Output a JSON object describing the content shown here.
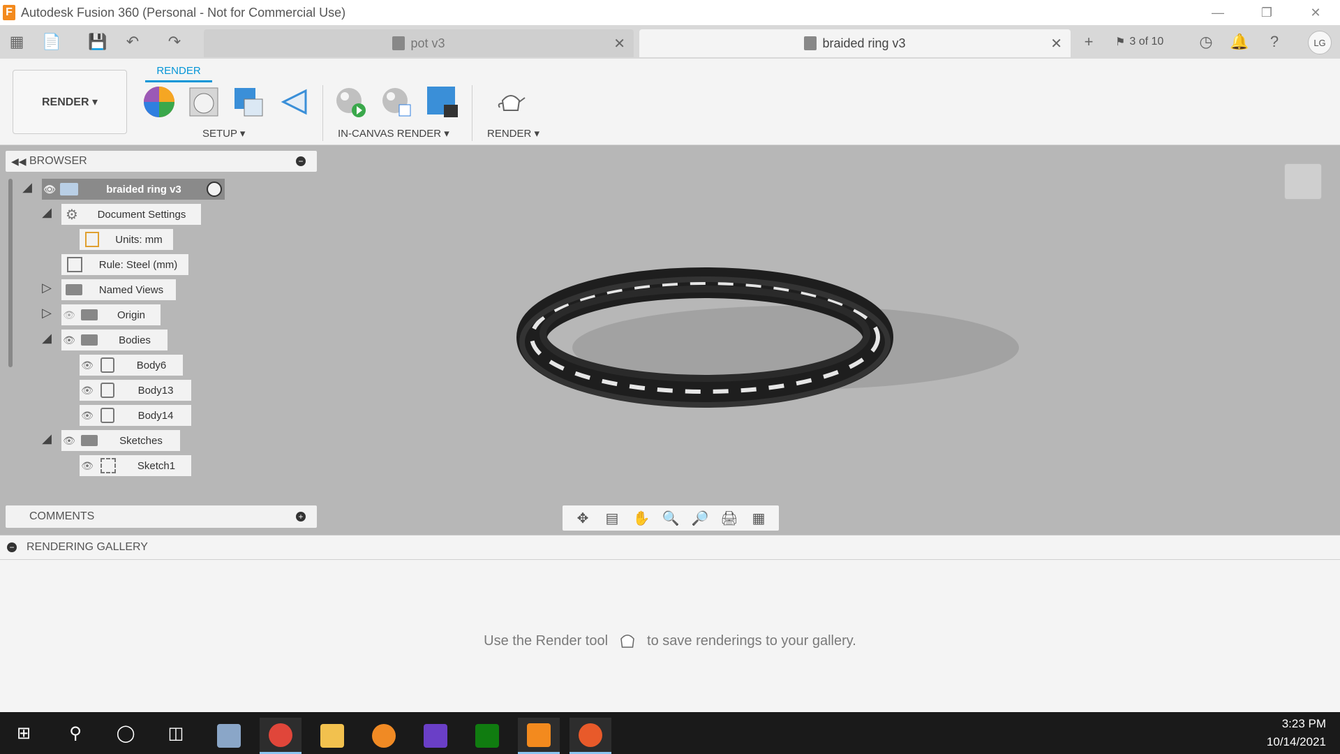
{
  "window": {
    "title": "Autodesk Fusion 360 (Personal - Not for Commercial Use)",
    "app_logo_letter": "F"
  },
  "tabs": [
    {
      "label": "pot v3",
      "active": false
    },
    {
      "label": "braided ring v3",
      "active": true
    }
  ],
  "quick_bar": {
    "version_counter": "3 of 10",
    "user_initials": "LG"
  },
  "ribbon": {
    "workspace": "RENDER ▾",
    "active_tab": "RENDER",
    "groups": [
      {
        "label": "SETUP ▾"
      },
      {
        "label": "IN-CANVAS RENDER ▾"
      },
      {
        "label": "RENDER ▾"
      }
    ]
  },
  "browser": {
    "title": "BROWSER",
    "root": "braided ring v3",
    "items": [
      {
        "label": "Document Settings"
      },
      {
        "label": "Units: mm"
      },
      {
        "label": "Rule: Steel (mm)"
      },
      {
        "label": "Named Views"
      },
      {
        "label": "Origin"
      },
      {
        "label": "Bodies"
      },
      {
        "label": "Body6"
      },
      {
        "label": "Body13"
      },
      {
        "label": "Body14"
      },
      {
        "label": "Sketches"
      },
      {
        "label": "Sketch1"
      }
    ]
  },
  "comments": {
    "title": "COMMENTS"
  },
  "gallery": {
    "title": "RENDERING GALLERY",
    "message_before": "Use the Render tool",
    "message_after": "to save renderings to your gallery."
  },
  "taskbar": {
    "time": "3:23 PM",
    "date": "10/14/2021"
  },
  "colors": {
    "accent": "#0696d7",
    "canvas_bg": "#b7b7b7",
    "fusion_orange": "#f38a1e"
  }
}
